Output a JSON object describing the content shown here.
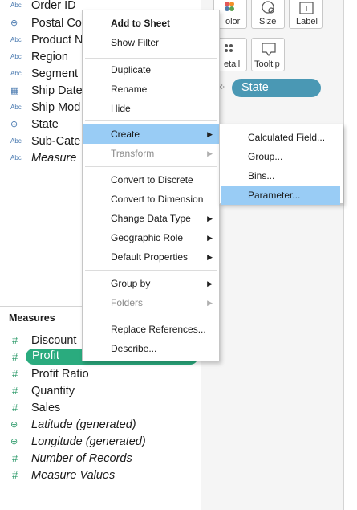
{
  "dimensions": {
    "fields": [
      {
        "icon": "abc-icon",
        "label": "Order ID"
      },
      {
        "icon": "globe-icon",
        "label": "Postal Co"
      },
      {
        "icon": "abc-icon",
        "label": "Product N"
      },
      {
        "icon": "abc-icon",
        "label": "Region"
      },
      {
        "icon": "abc-icon",
        "label": "Segment"
      },
      {
        "icon": "calendar-icon",
        "label": "Ship Date"
      },
      {
        "icon": "abc-icon",
        "label": "Ship Mod"
      },
      {
        "icon": "globe-icon",
        "label": "State"
      },
      {
        "icon": "abc-icon",
        "label": "Sub-Cate"
      },
      {
        "icon": "abc-icon",
        "label": "Measure"
      }
    ]
  },
  "measures": {
    "title": "Measures",
    "fields": [
      {
        "icon": "hash-icon",
        "label": "Discount"
      },
      {
        "icon": "hash-icon",
        "label": "Profit"
      },
      {
        "icon": "hash-icon",
        "label": "Profit Ratio"
      },
      {
        "icon": "hash-icon",
        "label": "Quantity"
      },
      {
        "icon": "hash-icon",
        "label": "Sales"
      },
      {
        "icon": "globe-icon",
        "label": "Latitude (generated)"
      },
      {
        "icon": "globe-icon",
        "label": "Longitude (generated)"
      },
      {
        "icon": "hash-icon",
        "label": "Number of Records"
      },
      {
        "icon": "hash-icon",
        "label": "Measure Values"
      }
    ]
  },
  "marks_card": {
    "color_label": "olor",
    "size_label": "Size",
    "label_label": "Label",
    "detail_label": "etail",
    "tooltip_label": "Tooltip",
    "state_pill": "State"
  },
  "context_menu": {
    "items": [
      {
        "label": "Add to Sheet"
      },
      {
        "label": "Show Filter"
      },
      {
        "label": "Duplicate"
      },
      {
        "label": "Rename"
      },
      {
        "label": "Hide"
      },
      {
        "label": "Create"
      },
      {
        "label": "Transform"
      },
      {
        "label": "Convert to Discrete"
      },
      {
        "label": "Convert to Dimension"
      },
      {
        "label": "Change Data Type"
      },
      {
        "label": "Geographic Role"
      },
      {
        "label": "Default Properties"
      },
      {
        "label": "Group by"
      },
      {
        "label": "Folders"
      },
      {
        "label": "Replace References..."
      },
      {
        "label": "Describe..."
      }
    ]
  },
  "submenu": {
    "items": [
      {
        "label": "Calculated Field..."
      },
      {
        "label": "Group..."
      },
      {
        "label": "Bins..."
      },
      {
        "label": "Parameter..."
      }
    ]
  },
  "colors": {
    "highlight": "#99ccf5",
    "profit_pill": "#2aab7e",
    "state_pill": "#4a98b4",
    "dimension_icon": "#4a7ab0",
    "measure_icon": "#2e9b6b"
  }
}
